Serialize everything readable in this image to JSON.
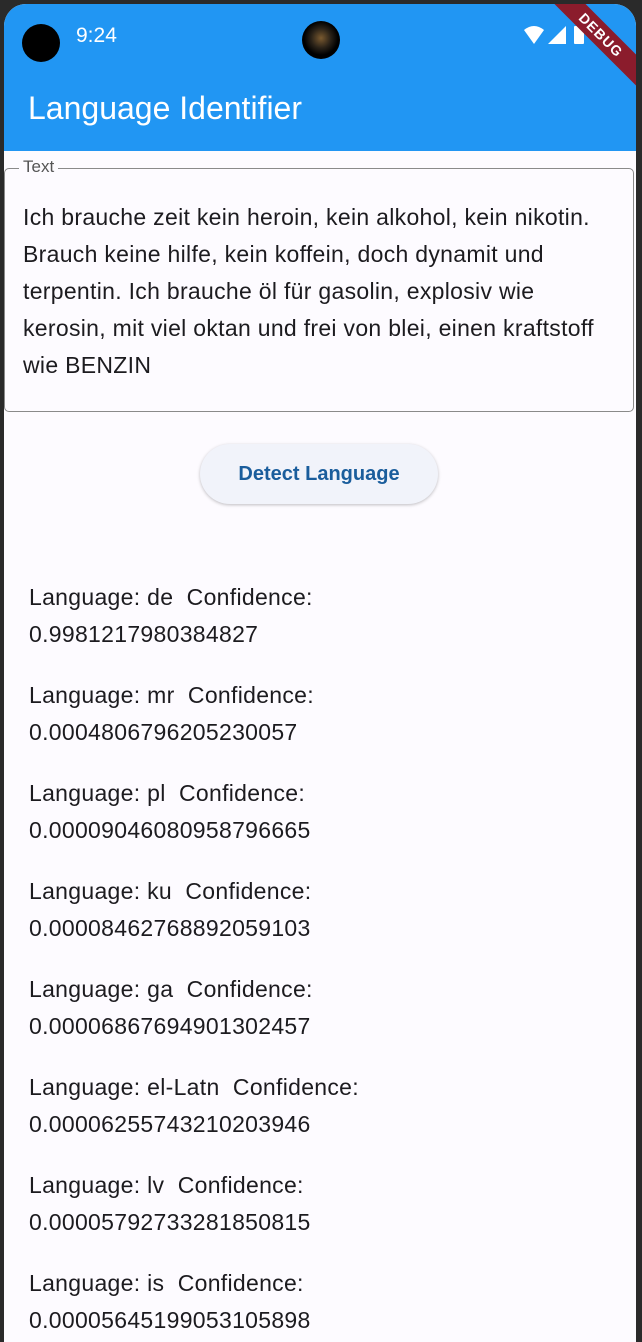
{
  "status_bar": {
    "time": "9:24",
    "icons": [
      "wifi-icon",
      "cellular-icon",
      "battery-icon"
    ]
  },
  "app_bar": {
    "title": "Language Identifier",
    "debug_banner": "DEBUG",
    "color": "#2196f3"
  },
  "input": {
    "label": "Text",
    "value": "Ich brauche zeit kein heroin, kein alkohol, kein nikotin. Brauch keine hilfe, kein koffein, doch dynamit und terpentin. Ich brauche öl für gasolin, explosiv wie kerosin, mit viel oktan und frei von blei, einen kraftstoff wie BENZIN"
  },
  "detect_button": {
    "label": "Detect Language",
    "text_color": "#1a5d9c"
  },
  "results": [
    {
      "line1": "Language: de  Confidence:",
      "line2": "0.9981217980384827"
    },
    {
      "line1": "Language: mr  Confidence:",
      "line2": "0.00048067962052300​57"
    },
    {
      "line1": "Language: pl  Confidence:",
      "line2": "0.000090460809587966​65"
    },
    {
      "line1": "Language: ku  Confidence:",
      "line2": "0.000084627688920591​03"
    },
    {
      "line1": "Language: ga  Confidence:",
      "line2": "0.000068676949013024​57"
    },
    {
      "line1": "Language: el-Latn  Confidence:",
      "line2": "0.000062557432102039​46"
    },
    {
      "line1": "Language: lv  Confidence:",
      "line2": "0.000057927332818508​15"
    },
    {
      "line1": "Language: is  Confidence:",
      "line2": "0.000056451990531058​98"
    }
  ]
}
